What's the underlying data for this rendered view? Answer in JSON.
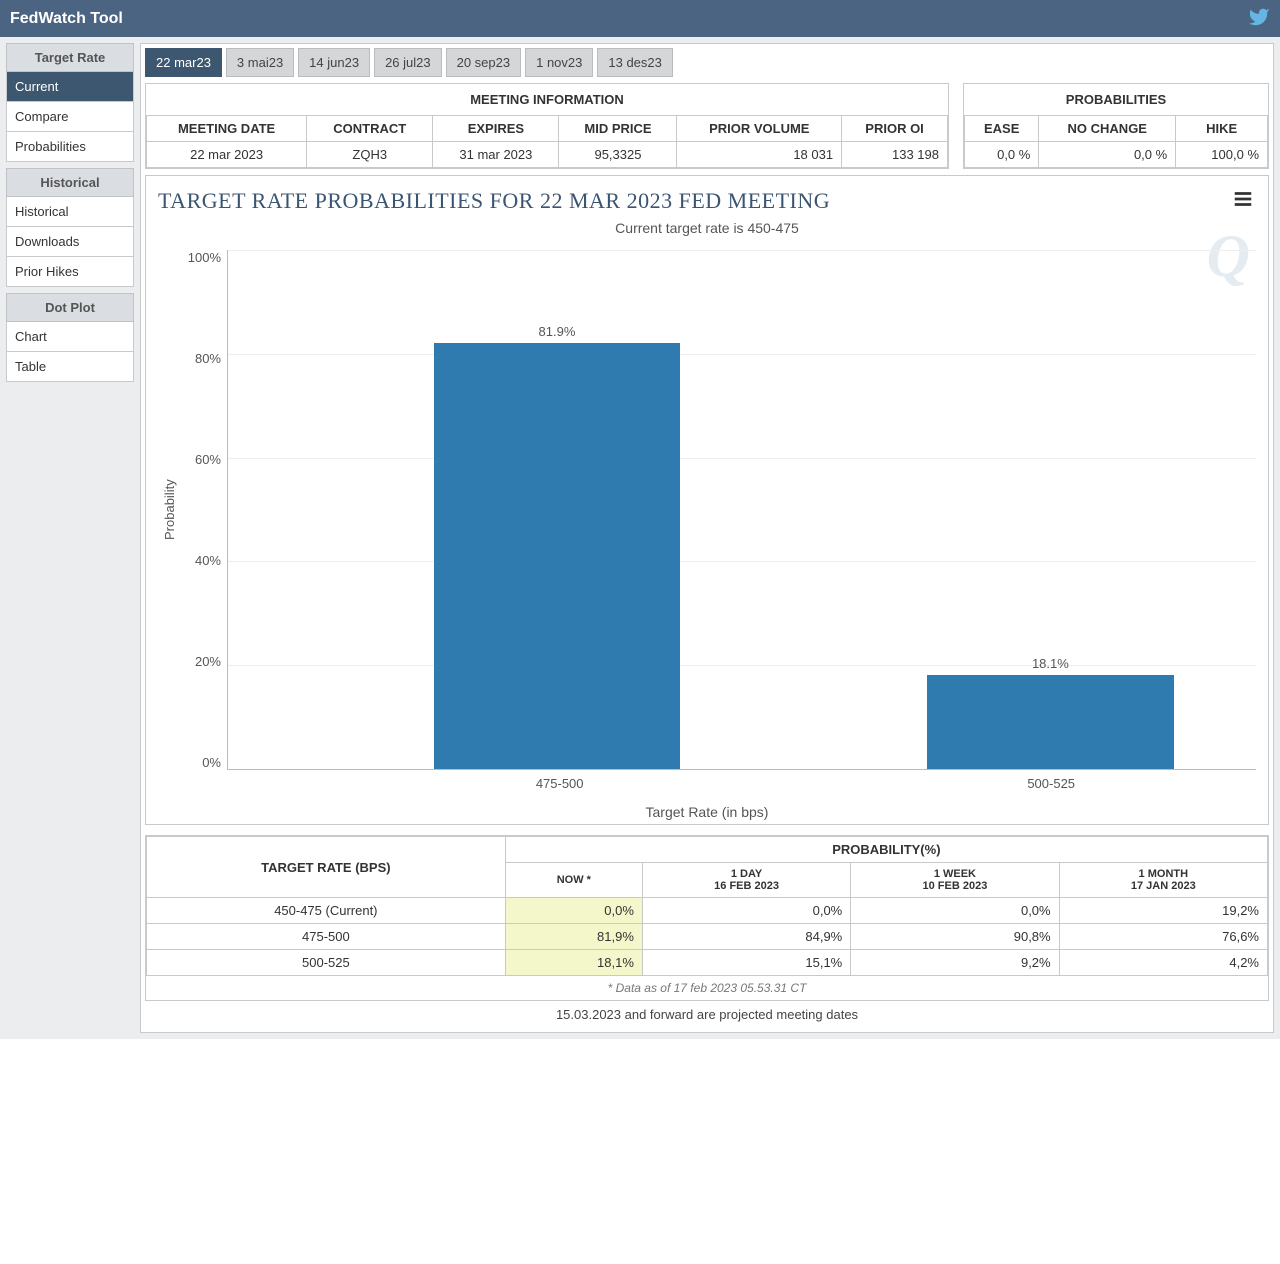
{
  "header": {
    "title": "FedWatch Tool"
  },
  "sidebar": {
    "groups": [
      {
        "title": "Target Rate",
        "items": [
          "Current",
          "Compare",
          "Probabilities"
        ],
        "active": 0
      },
      {
        "title": "Historical",
        "items": [
          "Historical",
          "Downloads",
          "Prior Hikes"
        ],
        "active": -1
      },
      {
        "title": "Dot Plot",
        "items": [
          "Chart",
          "Table"
        ],
        "active": -1
      }
    ]
  },
  "tabs": {
    "items": [
      "22 mar23",
      "3 mai23",
      "14 jun23",
      "26 jul23",
      "20 sep23",
      "1 nov23",
      "13 des23"
    ],
    "active": 0
  },
  "meeting_info": {
    "title": "MEETING INFORMATION",
    "headers": [
      "MEETING DATE",
      "CONTRACT",
      "EXPIRES",
      "MID PRICE",
      "PRIOR VOLUME",
      "PRIOR OI"
    ],
    "row": [
      "22 mar 2023",
      "ZQH3",
      "31 mar 2023",
      "95,3325",
      "18 031",
      "133 198"
    ]
  },
  "probabilities_summary": {
    "title": "PROBABILITIES",
    "headers": [
      "EASE",
      "NO CHANGE",
      "HIKE"
    ],
    "row": [
      "0,0 %",
      "0,0 %",
      "100,0 %"
    ]
  },
  "chart": {
    "title": "TARGET RATE PROBABILITIES FOR 22 MAR 2023 FED MEETING",
    "subtitle": "Current target rate is 450-475",
    "ylabel": "Probability",
    "xlabel": "Target Rate (in bps)",
    "yticks": [
      "100%",
      "80%",
      "60%",
      "40%",
      "20%",
      "0%"
    ]
  },
  "chart_data": {
    "type": "bar",
    "categories": [
      "475-500",
      "500-525"
    ],
    "values": [
      81.9,
      18.1
    ],
    "value_labels": [
      "81.9%",
      "18.1%"
    ],
    "title": "TARGET RATE PROBABILITIES FOR 22 MAR 2023 FED MEETING",
    "xlabel": "Target Rate (in bps)",
    "ylabel": "Probability",
    "ylim": [
      0,
      100
    ]
  },
  "history_table": {
    "target_header": "TARGET RATE (BPS)",
    "prob_header": "PROBABILITY(%)",
    "columns": [
      {
        "top": "NOW *",
        "sub": ""
      },
      {
        "top": "1 DAY",
        "sub": "16 FEB 2023"
      },
      {
        "top": "1 WEEK",
        "sub": "10 FEB 2023"
      },
      {
        "top": "1 MONTH",
        "sub": "17 JAN 2023"
      }
    ],
    "rows": [
      {
        "label": "450-475 (Current)",
        "cells": [
          "0,0%",
          "0,0%",
          "0,0%",
          "19,2%"
        ]
      },
      {
        "label": "475-500",
        "cells": [
          "81,9%",
          "84,9%",
          "90,8%",
          "76,6%"
        ]
      },
      {
        "label": "500-525",
        "cells": [
          "18,1%",
          "15,1%",
          "9,2%",
          "4,2%"
        ]
      }
    ],
    "footnote": "* Data as of 17 feb 2023 05.53.31 CT"
  },
  "projection_note": "15.03.2023 and forward are projected meeting dates"
}
